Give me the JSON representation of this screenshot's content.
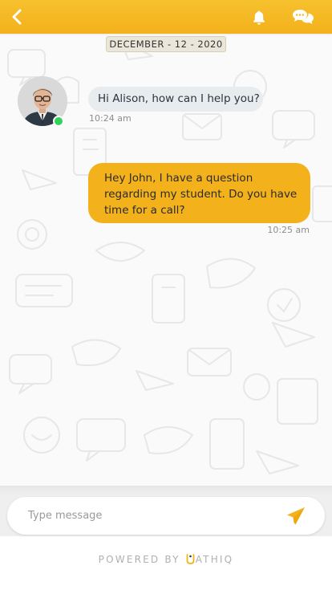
{
  "header": {
    "icons": {
      "back": "chevron-left-icon",
      "notifications": "bell-icon",
      "chat": "chat-bubbles-icon"
    },
    "color": "#F3B11B"
  },
  "conversation": {
    "date_chip": "DECEMBER - 12 - 2020",
    "contact": {
      "avatar": "avatar",
      "status": "online",
      "status_color": "#32d35a"
    },
    "messages": [
      {
        "direction": "incoming",
        "text": "Hi Alison, how can I help you?",
        "time": "10:24 am"
      },
      {
        "direction": "outgoing",
        "text": "Hey John, I have a question regarding my student. Do you have time for a call?",
        "time": "10:25 am"
      }
    ]
  },
  "composer": {
    "placeholder": "Type message",
    "send_icon": "paper-plane-icon",
    "send_color": "#F3B11B"
  },
  "footer": {
    "powered_by": "POWERED BY",
    "brand": "ATHIQ"
  }
}
